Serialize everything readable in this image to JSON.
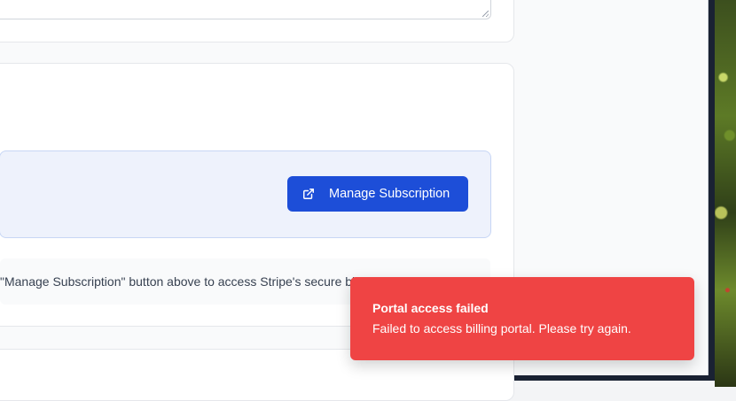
{
  "subscription": {
    "manage_button_label": "Manage Subscription",
    "manage_button_icon": "external-link-icon",
    "info_text": "\"Manage Subscription\" button above to access Stripe's secure billing portal."
  },
  "toast": {
    "title": "Portal access failed",
    "message": "Failed to access billing portal. Please try again.",
    "color": "#ef4444"
  },
  "colors": {
    "accent": "#1d4ed8",
    "panel_bg": "#eef2fc"
  }
}
